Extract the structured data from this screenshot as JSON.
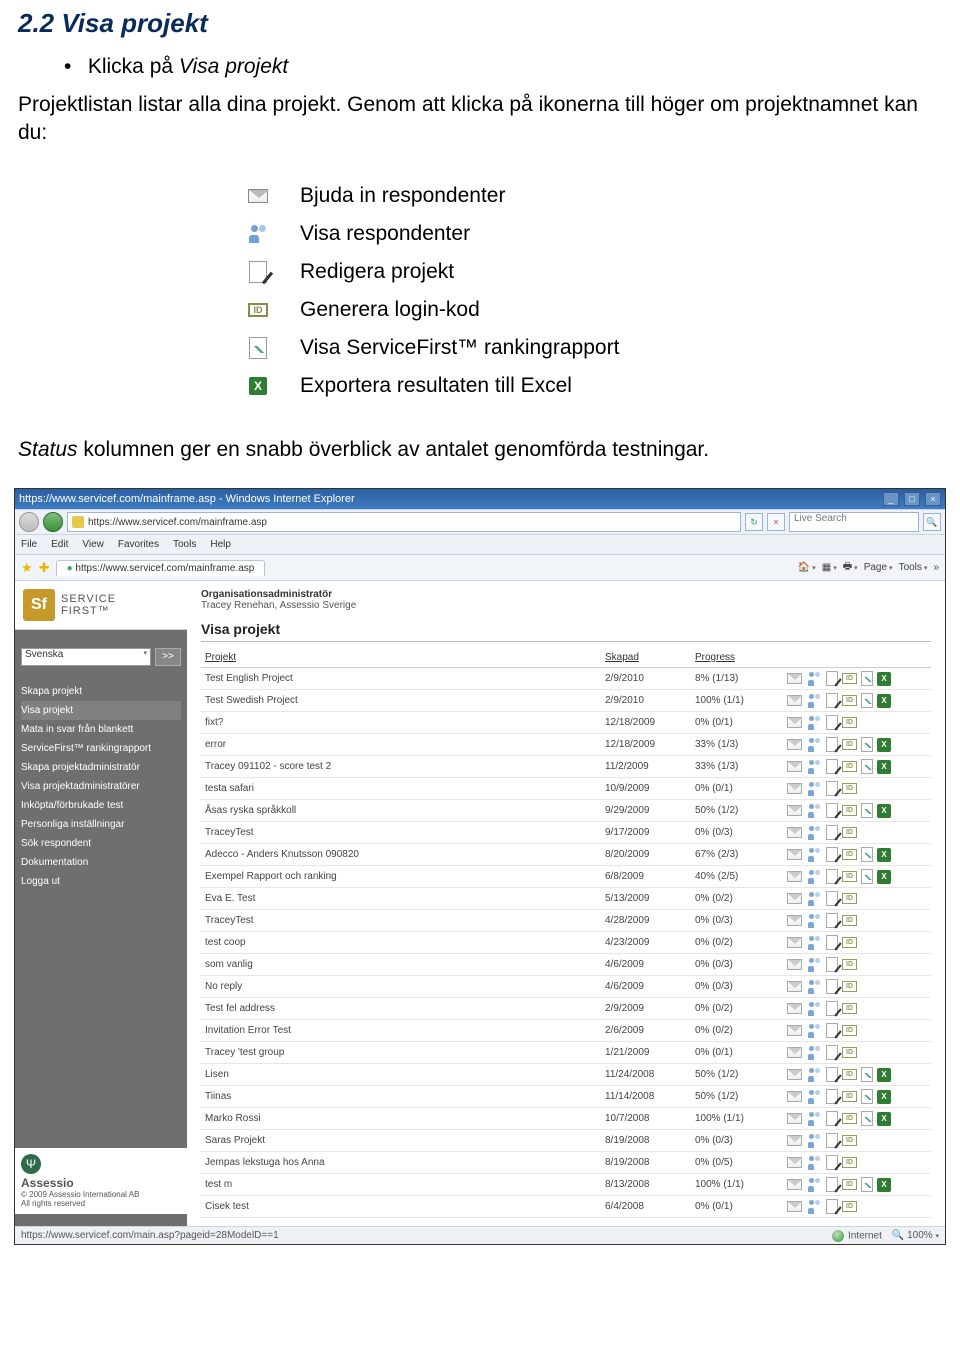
{
  "doc": {
    "headingNumber": "2.2",
    "headingTitle": "Visa projekt",
    "bulletPrefix": "Klicka på ",
    "bulletTarget": "Visa projekt",
    "paraPrefix": "Projektlistan listar alla dina projekt. Genom att klicka på ikonerna till höger om projektnamnet kan du:",
    "iconDefs": {
      "invite": "Bjuda in respondenter",
      "view": "Visa respondenter",
      "edit": "Redigera projekt",
      "id": "Generera login-kod",
      "chart": "Visa ServiceFirst™ rankingrapport",
      "excel": "Exportera resultaten till Excel"
    },
    "idLabel": "ID",
    "statusNotePrefix": "Status",
    "statusNoteRest": " kolumnen ger en snabb överblick av antalet genomförda testningar."
  },
  "browser": {
    "title": "https://www.servicef.com/mainframe.asp - Windows Internet Explorer",
    "url": "https://www.servicef.com/mainframe.asp",
    "searchPlaceholder": "Live Search",
    "menus": [
      "File",
      "Edit",
      "View",
      "Favorites",
      "Tools",
      "Help"
    ],
    "tabLabel": "https://www.servicef.com/mainframe.asp",
    "tools": {
      "page": "Page",
      "tools": "Tools"
    },
    "statusLeft": "https://www.servicef.com/main.asp?pageid=28ModelD==1",
    "statusZone": "Internet",
    "statusZoom": "100%"
  },
  "app": {
    "brandTop": "SERVICE",
    "brandBottom": "FIRST™",
    "brandMark": "Sf",
    "lang": "Svenska",
    "go": ">>",
    "nav": [
      "Skapa projekt",
      "Visa projekt",
      "Mata in svar från blankett",
      "ServiceFirst™ rankingrapport",
      "Skapa projektadministratör",
      "Visa projektadministratörer",
      "Inköpta/förbrukade test",
      "Personliga inställningar",
      "Sök respondent",
      "Dokumentation",
      "Logga ut"
    ],
    "footerBrand": "Assessio",
    "footerCopy": "© 2009 Assessio International AB",
    "footerRights": "All rights reserved",
    "orgAdminLabel": "Organisationsadministratör",
    "orgAdminName": "Tracey Renehan, Assessio Sverige",
    "panelTitle": "Visa projekt",
    "columns": {
      "projekt": "Projekt",
      "skapad": "Skapad",
      "progress": "Progress"
    },
    "idBadge": "ID",
    "projects": [
      {
        "name": "Test English Project",
        "created": "2/9/2010",
        "progress": "8% (1/13)",
        "actions": [
          "env",
          "ppl",
          "ed",
          "idb",
          "cht",
          "xls"
        ]
      },
      {
        "name": "Test Swedish Project",
        "created": "2/9/2010",
        "progress": "100% (1/1)",
        "actions": [
          "env",
          "ppl",
          "ed",
          "idb",
          "cht",
          "xls"
        ]
      },
      {
        "name": "fixt?",
        "created": "12/18/2009",
        "progress": "0% (0/1)",
        "actions": [
          "env",
          "ppl",
          "ed",
          "idb"
        ]
      },
      {
        "name": "error",
        "created": "12/18/2009",
        "progress": "33% (1/3)",
        "actions": [
          "env",
          "ppl",
          "ed",
          "idb",
          "cht",
          "xls"
        ]
      },
      {
        "name": "Tracey 091102 - score test 2",
        "created": "11/2/2009",
        "progress": "33% (1/3)",
        "actions": [
          "env",
          "ppl",
          "ed",
          "idb",
          "cht",
          "xls"
        ]
      },
      {
        "name": "testa safari",
        "created": "10/9/2009",
        "progress": "0% (0/1)",
        "actions": [
          "env",
          "ppl",
          "ed",
          "idb"
        ]
      },
      {
        "name": "Åsas ryska språkkoll",
        "created": "9/29/2009",
        "progress": "50% (1/2)",
        "actions": [
          "env",
          "ppl",
          "ed",
          "idb",
          "cht",
          "xls"
        ]
      },
      {
        "name": "TraceyTest",
        "created": "9/17/2009",
        "progress": "0% (0/3)",
        "actions": [
          "env",
          "ppl",
          "ed",
          "idb"
        ]
      },
      {
        "name": "Adecco - Anders Knutsson 090820",
        "created": "8/20/2009",
        "progress": "67% (2/3)",
        "actions": [
          "env",
          "ppl",
          "ed",
          "idb",
          "cht",
          "xls"
        ]
      },
      {
        "name": "Exempel Rapport och ranking",
        "created": "6/8/2009",
        "progress": "40% (2/5)",
        "actions": [
          "env",
          "ppl",
          "ed",
          "idb",
          "cht",
          "xls"
        ]
      },
      {
        "name": "Eva E. Test",
        "created": "5/13/2009",
        "progress": "0% (0/2)",
        "actions": [
          "env",
          "ppl",
          "ed",
          "idb"
        ]
      },
      {
        "name": "TraceyTest",
        "created": "4/28/2009",
        "progress": "0% (0/3)",
        "actions": [
          "env",
          "ppl",
          "ed",
          "idb"
        ]
      },
      {
        "name": "test coop",
        "created": "4/23/2009",
        "progress": "0% (0/2)",
        "actions": [
          "env",
          "ppl",
          "ed",
          "idb"
        ]
      },
      {
        "name": "som vanlig",
        "created": "4/6/2009",
        "progress": "0% (0/3)",
        "actions": [
          "env",
          "ppl",
          "ed",
          "idb"
        ]
      },
      {
        "name": "No reply",
        "created": "4/6/2009",
        "progress": "0% (0/3)",
        "actions": [
          "env",
          "ppl",
          "ed",
          "idb"
        ]
      },
      {
        "name": "Test fel address",
        "created": "2/9/2009",
        "progress": "0% (0/2)",
        "actions": [
          "env",
          "ppl",
          "ed",
          "idb"
        ]
      },
      {
        "name": "Invitation Error Test",
        "created": "2/6/2009",
        "progress": "0% (0/2)",
        "actions": [
          "env",
          "ppl",
          "ed",
          "idb"
        ]
      },
      {
        "name": "Tracey 'test group",
        "created": "1/21/2009",
        "progress": "0% (0/1)",
        "actions": [
          "env",
          "ppl",
          "ed",
          "idb"
        ]
      },
      {
        "name": "Lisen",
        "created": "11/24/2008",
        "progress": "50% (1/2)",
        "actions": [
          "env",
          "ppl",
          "ed",
          "idb",
          "cht",
          "xls"
        ]
      },
      {
        "name": "Tiinas",
        "created": "11/14/2008",
        "progress": "50% (1/2)",
        "actions": [
          "env",
          "ppl",
          "ed",
          "idb",
          "cht",
          "xls"
        ]
      },
      {
        "name": "Marko Rossi",
        "created": "10/7/2008",
        "progress": "100% (1/1)",
        "actions": [
          "env",
          "ppl",
          "ed",
          "idb",
          "cht",
          "xls"
        ]
      },
      {
        "name": "Saras Projekt",
        "created": "8/19/2008",
        "progress": "0% (0/3)",
        "actions": [
          "env",
          "ppl",
          "ed",
          "idb"
        ]
      },
      {
        "name": "Jempas lekstuga hos Anna",
        "created": "8/19/2008",
        "progress": "0% (0/5)",
        "actions": [
          "env",
          "ppl",
          "ed",
          "idb"
        ]
      },
      {
        "name": "test m",
        "created": "8/13/2008",
        "progress": "100% (1/1)",
        "actions": [
          "env",
          "ppl",
          "ed",
          "idb",
          "cht",
          "xls"
        ]
      },
      {
        "name": "Cisek test",
        "created": "6/4/2008",
        "progress": "0% (0/1)",
        "actions": [
          "env",
          "ppl",
          "ed",
          "idb"
        ]
      }
    ]
  }
}
